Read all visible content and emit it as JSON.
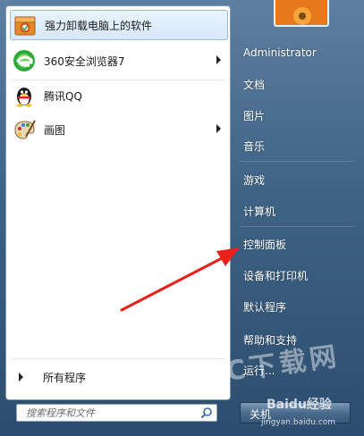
{
  "pinned_programs": [
    {
      "label": "强力卸载电脑上的软件",
      "icon": "uninstaller-box-icon",
      "submenu": false,
      "highlighted": true
    },
    {
      "label": "360安全浏览器7",
      "icon": "browser-360-icon",
      "submenu": true
    },
    {
      "label": "腾讯QQ",
      "icon": "qq-penguin-icon",
      "submenu": false
    },
    {
      "label": "画图",
      "icon": "paint-palette-icon",
      "submenu": true
    }
  ],
  "all_programs_label": "所有程序",
  "search": {
    "placeholder": "搜索程序和文件",
    "value": ""
  },
  "right_links": [
    {
      "label": "Administrator"
    },
    {
      "label": "文档"
    },
    {
      "label": "图片"
    },
    {
      "label": "音乐"
    },
    {
      "label": "游戏"
    },
    {
      "label": "计算机"
    },
    {
      "label": "控制面板"
    },
    {
      "label": "设备和打印机"
    },
    {
      "label": "默认程序"
    },
    {
      "label": "帮助和支持"
    },
    {
      "label": "运行..."
    }
  ],
  "shutdown_label": "关机",
  "watermarks": {
    "pc_download": "PC下载网",
    "baidu_jingyan": "Baidu经验",
    "url": "jingyan.baidu.com"
  },
  "colors": {
    "annotation_arrow": "#e8211a",
    "highlight": "#d6e8fb"
  }
}
